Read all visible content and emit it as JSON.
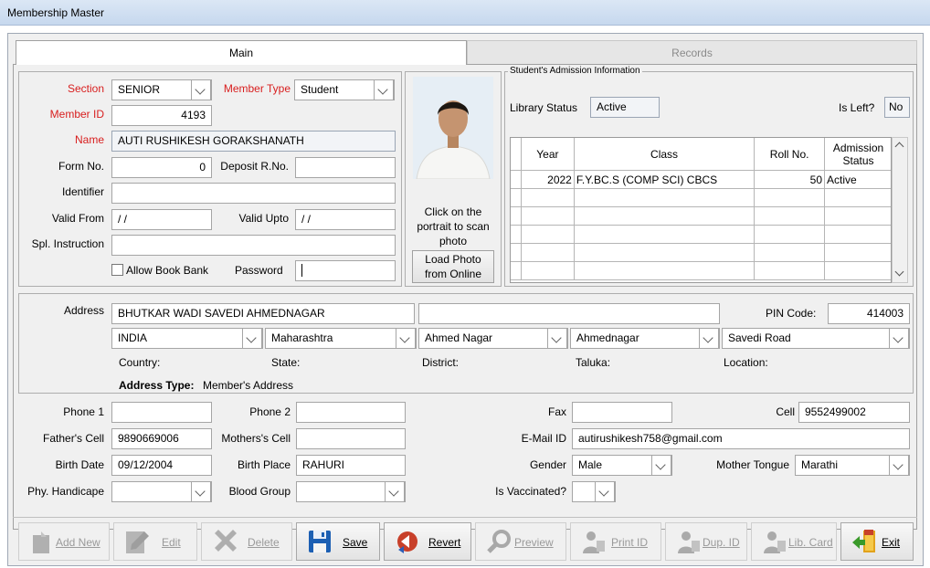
{
  "window": {
    "title": "Membership Master"
  },
  "tabs": {
    "main": "Main",
    "records": "Records"
  },
  "member": {
    "section_label": "Section",
    "section_value": "SENIOR",
    "member_type_label": "Member Type",
    "member_type_value": "Student",
    "member_id_label": "Member ID",
    "member_id_value": "4193",
    "name_label": "Name",
    "name_value": "AUTI RUSHIKESH GORAKSHANATH",
    "form_no_label": "Form No.",
    "form_no_value": "0",
    "deposit_label": "Deposit R.No.",
    "deposit_value": "",
    "identifier_label": "Identifier",
    "identifier_value": "",
    "valid_from_label": "Valid From",
    "valid_from_value": "/ /",
    "valid_upto_label": "Valid Upto",
    "valid_upto_value": "/ /",
    "spl_label": "Spl. Instruction",
    "spl_value": "",
    "allow_book_bank_label": "Allow Book Bank",
    "password_label": "Password",
    "password_value": ""
  },
  "photo": {
    "caption": "Click on the portrait to scan photo",
    "load_button": "Load Photo from Online"
  },
  "admission": {
    "group_title": "Student's Admission Information",
    "library_status_label": "Library Status",
    "library_status_value": "Active",
    "is_left_label": "Is Left?",
    "is_left_value": "No",
    "columns": [
      "Year",
      "Class",
      "Roll No.",
      "Admission Status"
    ],
    "rows": [
      [
        "2022",
        "F.Y.BC.S (COMP SCI) CBCS",
        "50",
        "Active"
      ]
    ]
  },
  "address": {
    "label": "Address",
    "line1": "BHUTKAR WADI SAVEDI AHMEDNAGAR",
    "line2": "",
    "pin_label": "PIN Code:",
    "pin_value": "414003",
    "country": "INDIA",
    "state": "Maharashtra",
    "district": "Ahmed Nagar",
    "taluka": "Ahmednagar",
    "location": "Savedi Road",
    "country_label": "Country:",
    "state_label": "State:",
    "district_label": "District:",
    "taluka_label": "Taluka:",
    "location_label": "Location:",
    "type_label": "Address Type:",
    "type_value": "Member's Address"
  },
  "contact": {
    "phone1_label": "Phone 1",
    "phone1_value": "",
    "phone2_label": "Phone 2",
    "phone2_value": "",
    "fax_label": "Fax",
    "fax_value": "",
    "cell_label": "Cell",
    "cell_value": "9552499002",
    "fathers_cell_label": "Father's Cell",
    "fathers_cell_value": "9890669006",
    "mothers_cell_label": "Mothers's Cell",
    "mothers_cell_value": "",
    "email_label": "E-Mail ID",
    "email_value": "autirushikesh758@gmail.com",
    "birth_date_label": "Birth Date",
    "birth_date_value": "09/12/2004",
    "birth_place_label": "Birth Place",
    "birth_place_value": "RAHURI",
    "gender_label": "Gender",
    "gender_value": "Male",
    "mother_tongue_label": "Mother Tongue",
    "mother_tongue_value": "Marathi",
    "phy_label": "Phy. Handicape",
    "phy_value": "",
    "blood_label": "Blood Group",
    "blood_value": "",
    "vaccinated_label": "Is Vaccinated?",
    "vaccinated_value": ""
  },
  "toolbar": {
    "add_new": "Add New",
    "edit": "Edit",
    "delete": "Delete",
    "save": "Save",
    "revert": "Revert",
    "preview": "Preview",
    "print_id": "Print ID",
    "dup_id": "Dup. ID",
    "lib_card": "Lib. Card",
    "exit": "Exit"
  },
  "colors": {
    "required_label": "#d81e1e",
    "save_icon": "#1c5fb3",
    "exit_icon": "#3a9a2a"
  }
}
